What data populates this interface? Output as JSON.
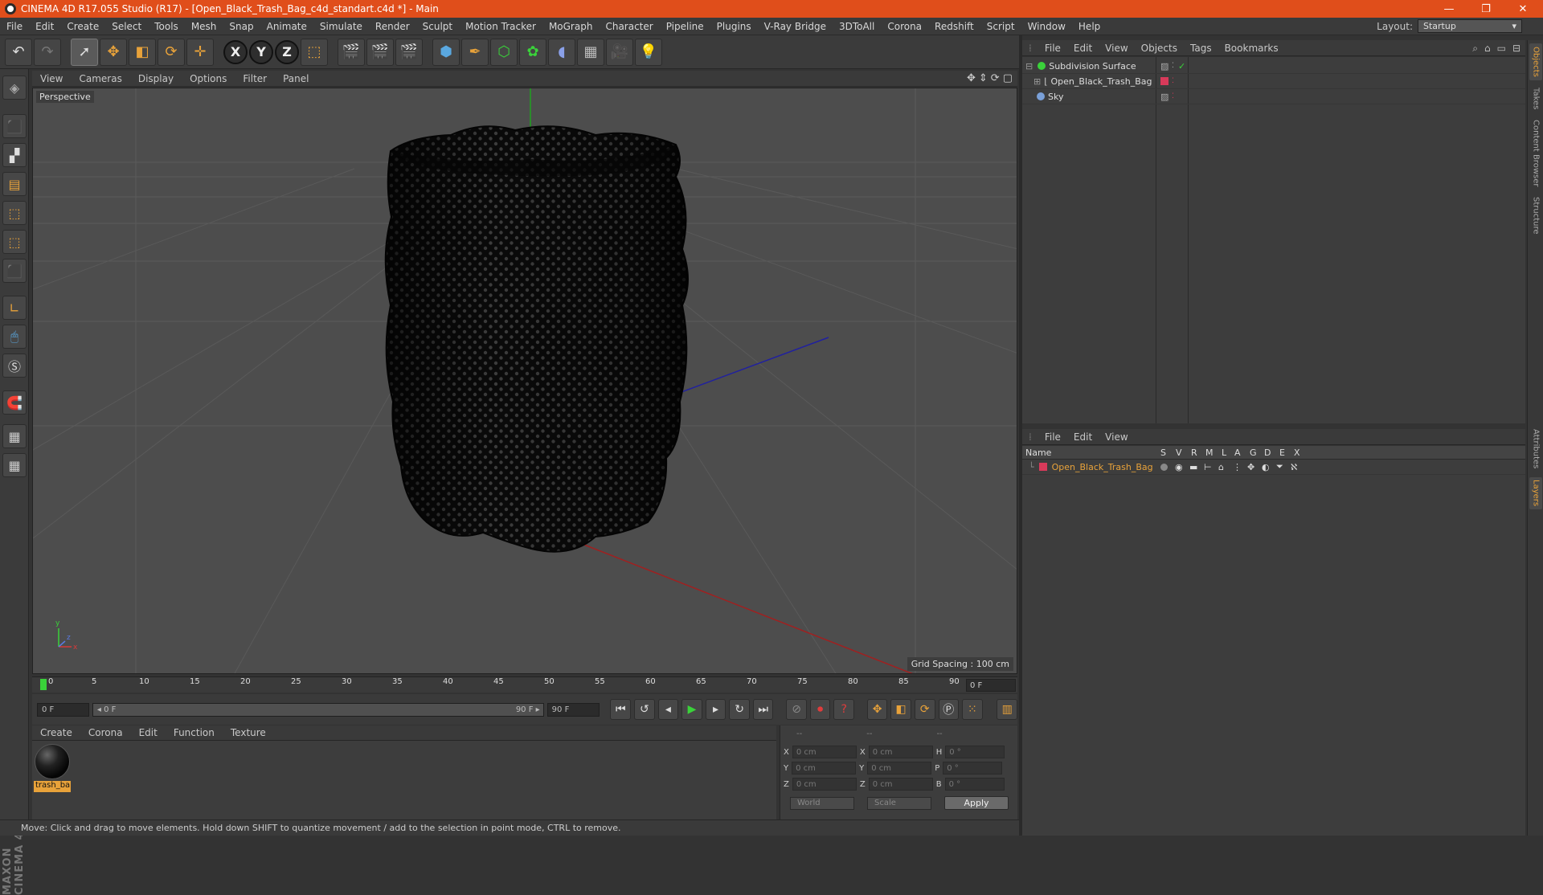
{
  "window": {
    "title": "CINEMA 4D R17.055 Studio (R17) - [Open_Black_Trash_Bag_c4d_standart.c4d *] - Main",
    "minimize": "—",
    "restore": "❐",
    "close": "✕"
  },
  "menu": [
    "File",
    "Edit",
    "Create",
    "Select",
    "Tools",
    "Mesh",
    "Snap",
    "Animate",
    "Simulate",
    "Render",
    "Sculpt",
    "Motion Tracker",
    "MoGraph",
    "Character",
    "Pipeline",
    "Plugins",
    "V-Ray Bridge",
    "3DToAll",
    "Corona",
    "Redshift",
    "Script",
    "Window",
    "Help"
  ],
  "layout": {
    "label": "Layout:",
    "value": "Startup"
  },
  "viewport": {
    "menu": [
      "View",
      "Cameras",
      "Display",
      "Options",
      "Filter",
      "Panel"
    ],
    "camera_label": "Perspective",
    "grid_spacing": "Grid Spacing : 100 cm"
  },
  "timeline": {
    "ticks": [
      "0",
      "5",
      "10",
      "15",
      "20",
      "25",
      "30",
      "35",
      "40",
      "45",
      "50",
      "55",
      "60",
      "65",
      "70",
      "75",
      "80",
      "85",
      "90"
    ],
    "current_frame": "0 F",
    "start_field": "0 F",
    "range_start": "◂ 0 F",
    "range_end": "90 F ▸",
    "end_field": "90 F"
  },
  "material_manager": {
    "menu": [
      "Create",
      "Corona",
      "Edit",
      "Function",
      "Texture"
    ],
    "material_name": "trash_ba"
  },
  "coordinates": {
    "header": [
      "--",
      "--",
      "--"
    ],
    "rows": [
      {
        "a": "X",
        "av": "0 cm",
        "b": "X",
        "bv": "0 cm",
        "c": "H",
        "cv": "0 °"
      },
      {
        "a": "Y",
        "av": "0 cm",
        "b": "Y",
        "bv": "0 cm",
        "c": "P",
        "cv": "0 °"
      },
      {
        "a": "Z",
        "av": "0 cm",
        "b": "Z",
        "bv": "0 cm",
        "c": "B",
        "cv": "0 °"
      }
    ],
    "space": "World",
    "mode": "Scale",
    "apply": "Apply"
  },
  "status": "Move: Click and drag to move elements. Hold down SHIFT to quantize movement / add to the selection in point mode, CTRL to remove.",
  "object_manager": {
    "menu": [
      "File",
      "Edit",
      "View",
      "Objects",
      "Tags",
      "Bookmarks"
    ],
    "objects": [
      {
        "name": "Subdivision Surface",
        "color": "#3ad23a"
      },
      {
        "name": "Open_Black_Trash_Bag",
        "color": "#cccccc"
      },
      {
        "name": "Sky",
        "color": "#7aa0d8"
      }
    ]
  },
  "layer_manager": {
    "menu": [
      "File",
      "Edit",
      "View"
    ],
    "columns": [
      "Name",
      "S",
      "V",
      "R",
      "M",
      "L",
      "A",
      "G",
      "D",
      "E",
      "X"
    ],
    "layers": [
      {
        "name": "Open_Black_Trash_Bag",
        "color": "#d83a5a"
      }
    ]
  },
  "right_tabs": [
    "Objects",
    "Takes",
    "Content Browser",
    "Structure",
    "Attributes",
    "Layers"
  ],
  "maxon": "MAXON CINEMA 4D",
  "colors": {
    "accent": "#e8a23a",
    "titlebar": "#e04e1b"
  }
}
